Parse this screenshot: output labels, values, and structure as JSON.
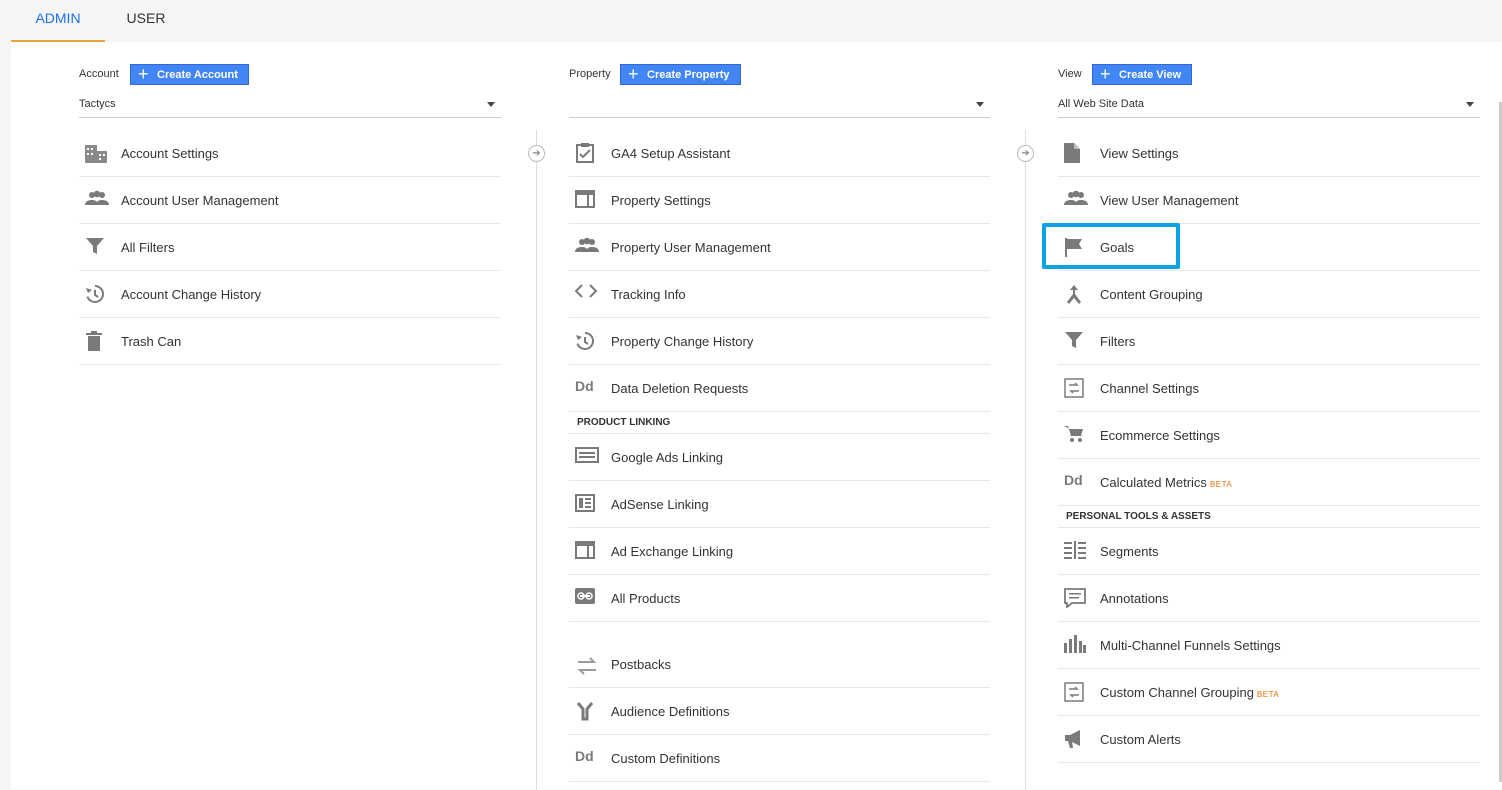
{
  "tabs": {
    "admin": "ADMIN",
    "user": "USER"
  },
  "account": {
    "label": "Account",
    "create": "Create Account",
    "selected": "Tactycs",
    "items": [
      {
        "label": "Account Settings",
        "icon": "building-icon"
      },
      {
        "label": "Account User Management",
        "icon": "people-icon"
      },
      {
        "label": "All Filters",
        "icon": "filter-icon"
      },
      {
        "label": "Account Change History",
        "icon": "history-icon"
      },
      {
        "label": "Trash Can",
        "icon": "trash-icon"
      }
    ]
  },
  "property": {
    "label": "Property",
    "create": "Create Property",
    "selected": "",
    "items": [
      {
        "label": "GA4 Setup Assistant",
        "icon": "clipboard-check-icon"
      },
      {
        "label": "Property Settings",
        "icon": "window-icon"
      },
      {
        "label": "Property User Management",
        "icon": "people-icon"
      },
      {
        "label": "Tracking Info",
        "icon": "code-icon"
      },
      {
        "label": "Property Change History",
        "icon": "history-icon"
      },
      {
        "label": "Data Deletion Requests",
        "icon": "dd-icon",
        "glyph": "Dd"
      }
    ],
    "section_title": "PRODUCT LINKING",
    "linking": [
      {
        "label": "Google Ads Linking",
        "icon": "ads-icon"
      },
      {
        "label": "AdSense Linking",
        "icon": "adsense-icon"
      },
      {
        "label": "Ad Exchange Linking",
        "icon": "window-icon"
      },
      {
        "label": "All Products",
        "icon": "link-icon"
      }
    ],
    "more": [
      {
        "label": "Postbacks",
        "icon": "swap-icon"
      },
      {
        "label": "Audience Definitions",
        "icon": "fork-icon"
      },
      {
        "label": "Custom Definitions",
        "icon": "dd-icon",
        "glyph": "Dd"
      }
    ]
  },
  "view": {
    "label": "View",
    "create": "Create View",
    "selected": "All Web Site Data",
    "items": [
      {
        "label": "View Settings",
        "icon": "document-icon"
      },
      {
        "label": "View User Management",
        "icon": "people-icon"
      },
      {
        "label": "Goals",
        "icon": "flag-icon"
      },
      {
        "label": "Content Grouping",
        "icon": "merge-icon"
      },
      {
        "label": "Filters",
        "icon": "filter-icon"
      },
      {
        "label": "Channel Settings",
        "icon": "channel-icon"
      },
      {
        "label": "Ecommerce Settings",
        "icon": "cart-icon"
      },
      {
        "label": "Calculated Metrics",
        "icon": "dd-icon",
        "glyph": "Dd",
        "badge": "BETA"
      }
    ],
    "section_title": "PERSONAL TOOLS & ASSETS",
    "tools": [
      {
        "label": "Segments",
        "icon": "segments-icon"
      },
      {
        "label": "Annotations",
        "icon": "comment-icon"
      },
      {
        "label": "Multi-Channel Funnels Settings",
        "icon": "bars-icon"
      },
      {
        "label": "Custom Channel Grouping",
        "icon": "channel-icon",
        "badge": "BETA"
      },
      {
        "label": "Custom Alerts",
        "icon": "megaphone-icon"
      }
    ]
  },
  "colors": {
    "accent": "#1a73e8",
    "button": "#4285f4",
    "highlight": "#0aa3e6",
    "tab_underline": "#e8a53a",
    "beta": "#e8710a"
  }
}
